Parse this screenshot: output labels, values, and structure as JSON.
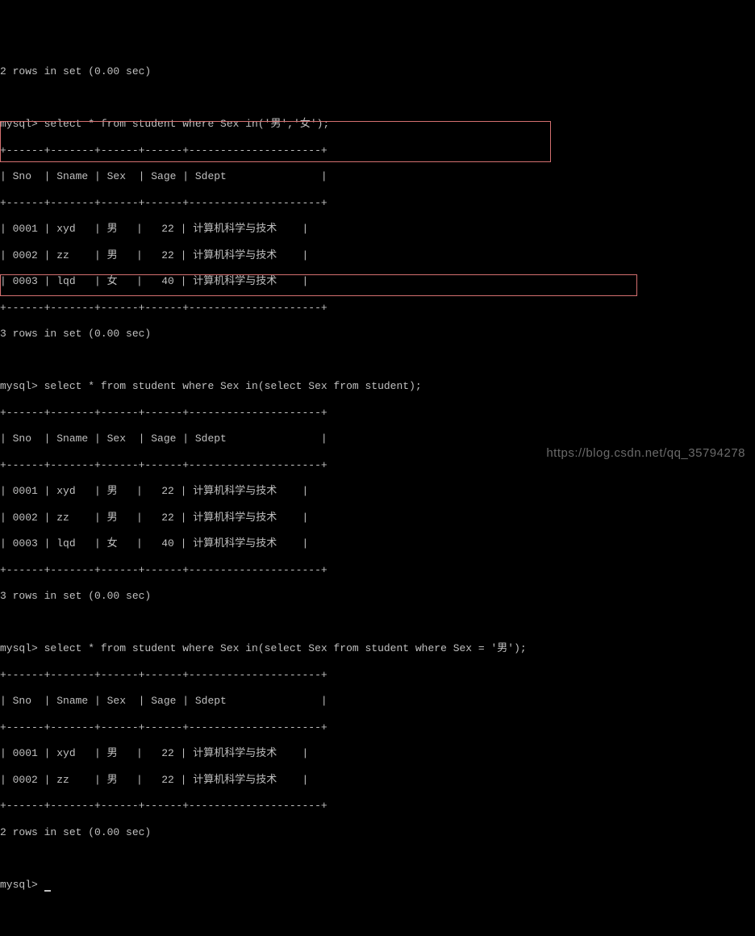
{
  "top_line": "2 rows in set (0.00 sec)",
  "query1": {
    "prompt": "mysql> ",
    "sql": "select * from student where Sex in('男','女');",
    "border": "+------+-------+------+------+---------------------+",
    "header": "| Sno  | Sname | Sex  | Sage | Sdept               |",
    "rows": [
      "| 0001 | xyd   | 男   |   22 | 计算机科学与技术    |",
      "| 0002 | zz    | 男   |   22 | 计算机科学与技术    |",
      "| 0003 | lqd   | 女   |   40 | 计算机科学与技术    |"
    ],
    "footer": "3 rows in set (0.00 sec)"
  },
  "query2": {
    "prompt": "mysql> ",
    "sql": "select * from student where Sex in(select Sex from student);",
    "border": "+------+-------+------+------+---------------------+",
    "header": "| Sno  | Sname | Sex  | Sage | Sdept               |",
    "rows": [
      "| 0001 | xyd   | 男   |   22 | 计算机科学与技术    |",
      "| 0002 | zz    | 男   |   22 | 计算机科学与技术    |",
      "| 0003 | lqd   | 女   |   40 | 计算机科学与技术    |"
    ],
    "footer": "3 rows in set (0.00 sec)"
  },
  "query3": {
    "prompt": "mysql> ",
    "sql": "select * from student where Sex in(select Sex from student where Sex = '男');",
    "border": "+------+-------+------+------+---------------------+",
    "header": "| Sno  | Sname | Sex  | Sage | Sdept               |",
    "rows": [
      "| 0001 | xyd   | 男   |   22 | 计算机科学与技术    |",
      "| 0002 | zz    | 男   |   22 | 计算机科学与技术    |"
    ],
    "footer": "2 rows in set (0.00 sec)"
  },
  "final_prompt": "mysql> ",
  "watermark": "https://blog.csdn.net/qq_35794278"
}
